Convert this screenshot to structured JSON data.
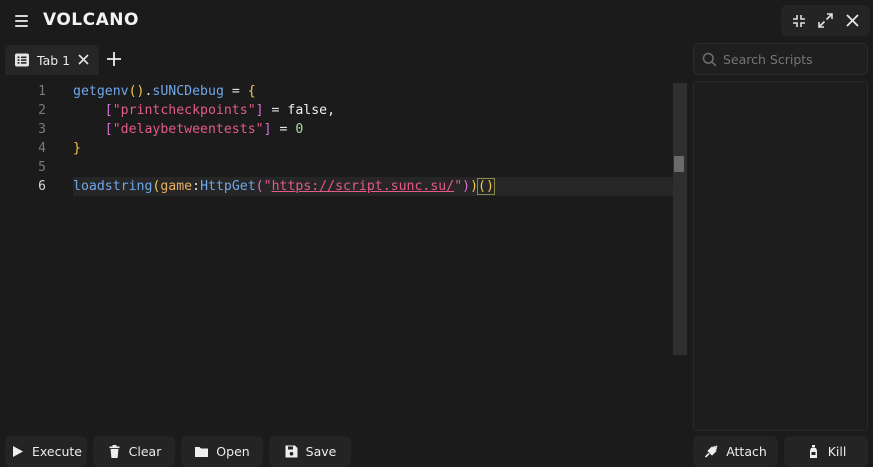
{
  "app": {
    "title": "VOLCANO"
  },
  "tabs": [
    {
      "label": "Tab 1"
    }
  ],
  "editor": {
    "line_numbers": [
      "1",
      "2",
      "3",
      "4",
      "5",
      "6"
    ],
    "active_line": 6,
    "lines": [
      [
        {
          "t": "getgenv",
          "c": "t-fn"
        },
        {
          "t": "()",
          "c": "t-paren"
        },
        {
          "t": ".",
          "c": ""
        },
        {
          "t": "sUNCDebug",
          "c": "t-prop"
        },
        {
          "t": " = ",
          "c": ""
        },
        {
          "t": "{",
          "c": "t-paren"
        }
      ],
      [
        {
          "t": "    ",
          "c": ""
        },
        {
          "t": "[",
          "c": "t-sq"
        },
        {
          "t": "\"printcheckpoints\"",
          "c": "t-str"
        },
        {
          "t": "]",
          "c": "t-sq"
        },
        {
          "t": " = ",
          "c": ""
        },
        {
          "t": "false",
          "c": "t-bool"
        },
        {
          "t": ",",
          "c": ""
        }
      ],
      [
        {
          "t": "    ",
          "c": ""
        },
        {
          "t": "[",
          "c": "t-sq"
        },
        {
          "t": "\"delaybetweentests\"",
          "c": "t-str"
        },
        {
          "t": "]",
          "c": "t-sq"
        },
        {
          "t": " = ",
          "c": ""
        },
        {
          "t": "0",
          "c": "t-num"
        }
      ],
      [
        {
          "t": "}",
          "c": "t-paren"
        }
      ],
      [],
      [
        {
          "t": "loadstring",
          "c": "t-fn"
        },
        {
          "t": "(",
          "c": "t-paren"
        },
        {
          "t": "game",
          "c": "t-game"
        },
        {
          "t": ":",
          "c": ""
        },
        {
          "t": "HttpGet",
          "c": "t-fn"
        },
        {
          "t": "(",
          "c": "t-sq"
        },
        {
          "t": "\"",
          "c": "t-str"
        },
        {
          "t": "https://script.sunc.su/",
          "c": "t-str-url"
        },
        {
          "t": "\"",
          "c": "t-str"
        },
        {
          "t": ")",
          "c": "t-sq"
        },
        {
          "t": ")",
          "c": "t-paren"
        },
        {
          "t": "()",
          "c": "t-paren bracket-match"
        }
      ]
    ]
  },
  "sidebar": {
    "search_placeholder": "Search Scripts"
  },
  "buttons": {
    "execute": "Execute",
    "clear": "Clear",
    "open": "Open",
    "save": "Save",
    "attach": "Attach",
    "kill": "Kill"
  },
  "icons": {
    "menu": "menu-icon",
    "minimize": "minimize-icon",
    "maximize": "maximize-icon",
    "close": "close-icon",
    "tab": "list-icon",
    "tab_close": "close-icon",
    "add_tab": "plus-icon",
    "search": "search-icon",
    "execute": "play-icon",
    "clear": "trash-icon",
    "open": "folder-icon",
    "save": "floppy-icon",
    "attach": "plug-icon",
    "kill": "bottle-icon"
  },
  "colors": {
    "background": "#1b1b1b",
    "panel": "#242424",
    "function": "#6fa6e8",
    "string": "#e45a8a",
    "bracket": "#f2c94c",
    "number": "#a9df9a"
  }
}
